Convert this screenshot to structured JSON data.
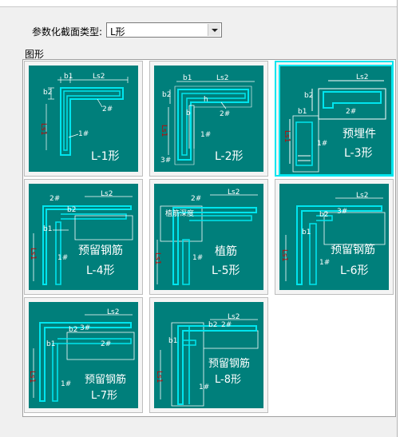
{
  "combo": {
    "label": "参数化截面类型:",
    "value": "L形"
  },
  "group": {
    "label": "图形"
  },
  "tiles": [
    {
      "caption": "L-1形",
      "note": ""
    },
    {
      "caption": "L-2形",
      "note": ""
    },
    {
      "caption": "L-3形",
      "note": "预埋件"
    },
    {
      "caption": "L-4形",
      "note": "预留钢筋"
    },
    {
      "caption": "L-5形",
      "note": "植筋"
    },
    {
      "caption": "L-6形",
      "note": "预留钢筋"
    },
    {
      "caption": "L-7形",
      "note": "预留钢筋"
    },
    {
      "caption": "L-8形",
      "note": "预留钢筋"
    }
  ],
  "dims": {
    "b1": "b1",
    "b2": "b2",
    "ls2": "Ls2",
    "ls1": "Ls1",
    "h": "h",
    "b": "b",
    "r1": "1#",
    "r2": "2#",
    "r3": "3#",
    "depth": "植筋深度"
  },
  "colors": {
    "tile_bg": "#007f7b",
    "rebar": "#00e5ee",
    "dim": "#ffffff",
    "ls1": "#c80000",
    "selected": "#00e5ee"
  },
  "selected_index": 2
}
